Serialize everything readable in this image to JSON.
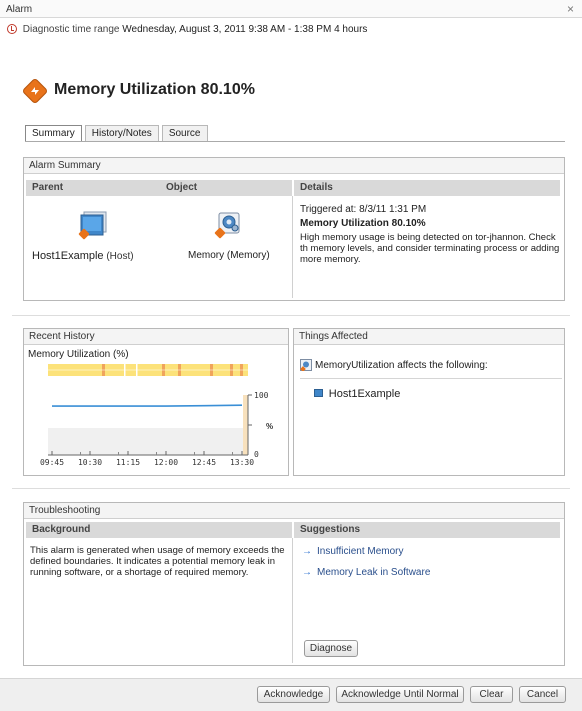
{
  "window": {
    "title": "Alarm",
    "close_glyph": "×"
  },
  "time_range": {
    "label": "Diagnostic time range",
    "value": "Wednesday, August 3, 2011  9:38 AM - 1:38 PM  4 hours"
  },
  "alarm": {
    "title": "Memory Utilization 80.10%",
    "icon": "alarm-diamond-icon"
  },
  "tabs": [
    {
      "label": "Summary",
      "active": true
    },
    {
      "label": "History/Notes"
    },
    {
      "label": "Source"
    }
  ],
  "alarm_summary": {
    "title": "Alarm Summary",
    "col_parent": "Parent",
    "col_object": "Object",
    "col_details": "Details",
    "parent_name": "Host1Example",
    "parent_type": "(Host)",
    "object_label": "Memory (Memory)",
    "triggered": "Triggered at: 8/3/11 1:31 PM",
    "detail_title": "Memory Utilization 80.10%",
    "detail_text": "High memory usage is being detected on tor-jhannon. Check th memory levels, and consider terminating process or adding more memory."
  },
  "recent_history": {
    "title": "Recent History",
    "chart_title": "Memory Utilization (%)"
  },
  "chart_data": {
    "type": "line",
    "title": "Memory Utilization (%)",
    "ylabel": "%",
    "x": [
      "09:45",
      "10:30",
      "11:15",
      "12:00",
      "12:45",
      "13:30"
    ],
    "series": [
      {
        "values": [
          78,
          78,
          78,
          78,
          79,
          80
        ]
      }
    ],
    "ylim": [
      0,
      100
    ],
    "y_ticks": [
      "100",
      "0"
    ],
    "status_strip": {
      "colors": {
        "warning": "#fce27a",
        "critical": "#f0a45c"
      },
      "critical_fractions": [
        0.27,
        0.57,
        0.65,
        0.81,
        0.91,
        0.96
      ]
    }
  },
  "things_affected": {
    "title": "Things Affected",
    "header": "MemoryUtilization affects the following:",
    "items": [
      "Host1Example"
    ]
  },
  "troubleshooting": {
    "title": "Troubleshooting",
    "col_background": "Background",
    "col_suggestions": "Suggestions",
    "background_text": "This alarm is generated when usage of memory exceeds the defined boundaries. It indicates a potential memory leak in running software, or a shortage of required memory.",
    "suggestions": [
      "Insufficient Memory",
      "Memory Leak in Software"
    ],
    "diagnose_label": "Diagnose"
  },
  "footer": {
    "acknowledge": "Acknowledge",
    "acknowledge_until_normal": "Acknowledge Until Normal",
    "clear": "Clear",
    "cancel": "Cancel"
  },
  "colors": {
    "accent": "#e8731a",
    "link": "#2a4f8c",
    "line": "#3a8fd6",
    "header_gray": "#d9d9d9"
  }
}
